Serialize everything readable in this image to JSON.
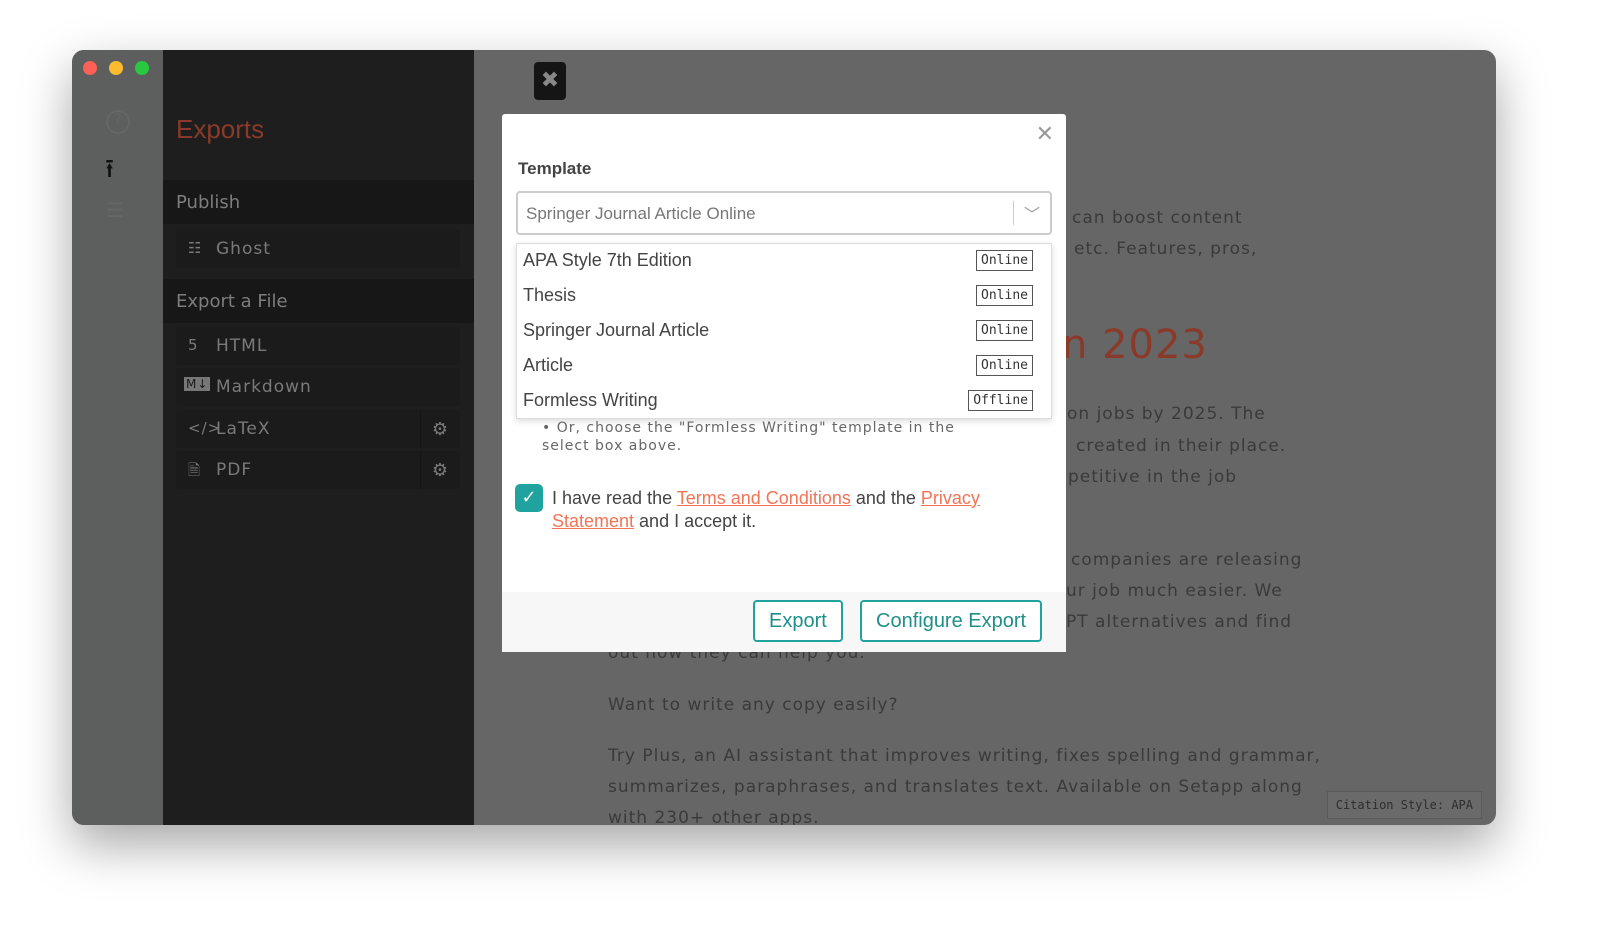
{
  "window": {
    "controls": [
      "close",
      "minimize",
      "maximize"
    ],
    "colors": {
      "close": "#fe5f57",
      "minimize": "#febc2e",
      "maximize": "#28c840"
    }
  },
  "rail": {
    "icons": [
      "help-icon",
      "upload-icon",
      "list-icon"
    ]
  },
  "sidebar": {
    "title": "Exports",
    "publish_label": "Publish",
    "publish_items": [
      {
        "label": "Ghost",
        "icon": "ghost-icon"
      }
    ],
    "export_label": "Export a File",
    "export_items": [
      {
        "label": "HTML",
        "icon": "html5-icon",
        "glyph": "5"
      },
      {
        "label": "Markdown",
        "icon": "markdown-icon",
        "glyph": "M↓"
      },
      {
        "label": "LaTeX",
        "icon": "code-icon",
        "glyph": "</>"
      },
      {
        "label": "PDF",
        "icon": "pdf-icon",
        "glyph": "🗎"
      }
    ]
  },
  "background": {
    "lines": [
      "can boost content",
      "etc. Features, pros,",
      "n 2023",
      "on jobs by 2025. The",
      "created in their place.",
      "petitive in the job",
      "companies are releasing",
      "ur job much easier. We",
      "PT alternatives and find",
      "out how they can help you.",
      "Want to write any copy easily?",
      "Try Plus, an AI assistant that improves writing, fixes spelling and grammar,",
      "summarizes, paraphrases, and translates text. Available on Setapp along",
      "with 230+ other apps."
    ],
    "citation": "Citation Style: APA",
    "heading_color": "#8a3a28"
  },
  "modal": {
    "label": "Template",
    "selected": "Springer Journal Article Online",
    "options": [
      {
        "name": "APA Style 7th Edition",
        "status": "Online"
      },
      {
        "name": "Thesis",
        "status": "Online"
      },
      {
        "name": "Springer Journal Article",
        "status": "Online"
      },
      {
        "name": "Article",
        "status": "Online"
      },
      {
        "name": "Formless Writing",
        "status": "Offline"
      }
    ],
    "note": "Or, choose the \"Formless Writing\" template in the select box above.",
    "agree": {
      "checked": true,
      "t1": "I have read the ",
      "link1": "Terms and Conditions",
      "t2": " and the ",
      "link2": "Privacy Statement",
      "t3": " and I accept it."
    },
    "export_button": "Export",
    "configure_button": "Configure Export",
    "accent": "#20a39e"
  }
}
